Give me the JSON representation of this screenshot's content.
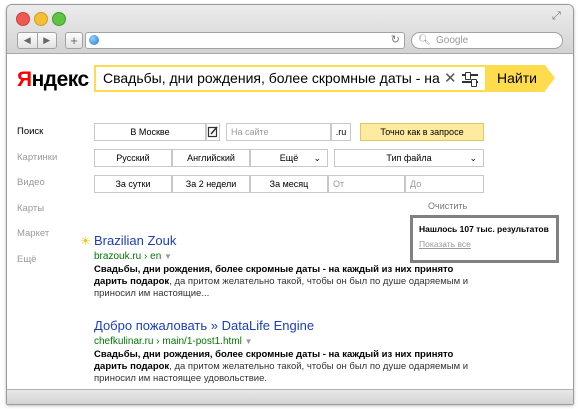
{
  "browser": {
    "search_placeholder": "Google"
  },
  "yandex": {
    "logo_first": "Я",
    "logo_rest": "ндекс",
    "query": "Свадьбы, дни рождения, более скромные даты - на кажд",
    "search_button": "Найти"
  },
  "left_nav": [
    {
      "label": "Поиск",
      "active": true
    },
    {
      "label": "Картинки",
      "active": false
    },
    {
      "label": "Видео",
      "active": false
    },
    {
      "label": "Карты",
      "active": false
    },
    {
      "label": "Маркет",
      "active": false
    },
    {
      "label": "Ещё",
      "active": false
    }
  ],
  "filters": {
    "region": "В Москве",
    "site_placeholder": "На сайте",
    "tld": ".ru",
    "exact": "Точно как в запросе",
    "russian": "Русский",
    "english": "Английский",
    "more": "Ещё",
    "filetype": "Тип файла",
    "day": "За сутки",
    "two_weeks": "За 2 недели",
    "month": "За месяц",
    "from": "От",
    "to": "До",
    "clear": "Очистить"
  },
  "summary": {
    "found": "Нашлось 107 тыс. результатов",
    "show_all": "Показать все"
  },
  "results": [
    {
      "title": "Brazilian Zouk",
      "url": "brazouk.ru › en",
      "snippet_bold": "Свадьбы, дни рождения, более скромные даты - на каждый из них принято дарить подарок",
      "snippet_rest": ", да притом желательно такой, чтобы он был по душе одаряемым и приносил им настоящие..."
    },
    {
      "title": "Добро пожаловать » DataLife Engine",
      "url": "chefkulinar.ru › main/1-post1.html",
      "snippet_bold": "Свадьбы, дни рождения, более скромные даты - на каждый из них принято дарить подарок",
      "snippet_rest": ", да притом желательно такой, чтобы он был по душе одаряемым и приносил им настоящее удовольствие."
    }
  ],
  "colors": {
    "accent_yellow": "#ffdb4d",
    "link_blue": "#1a3dc1",
    "url_green": "#007700",
    "logo_red": "#ff0000"
  }
}
